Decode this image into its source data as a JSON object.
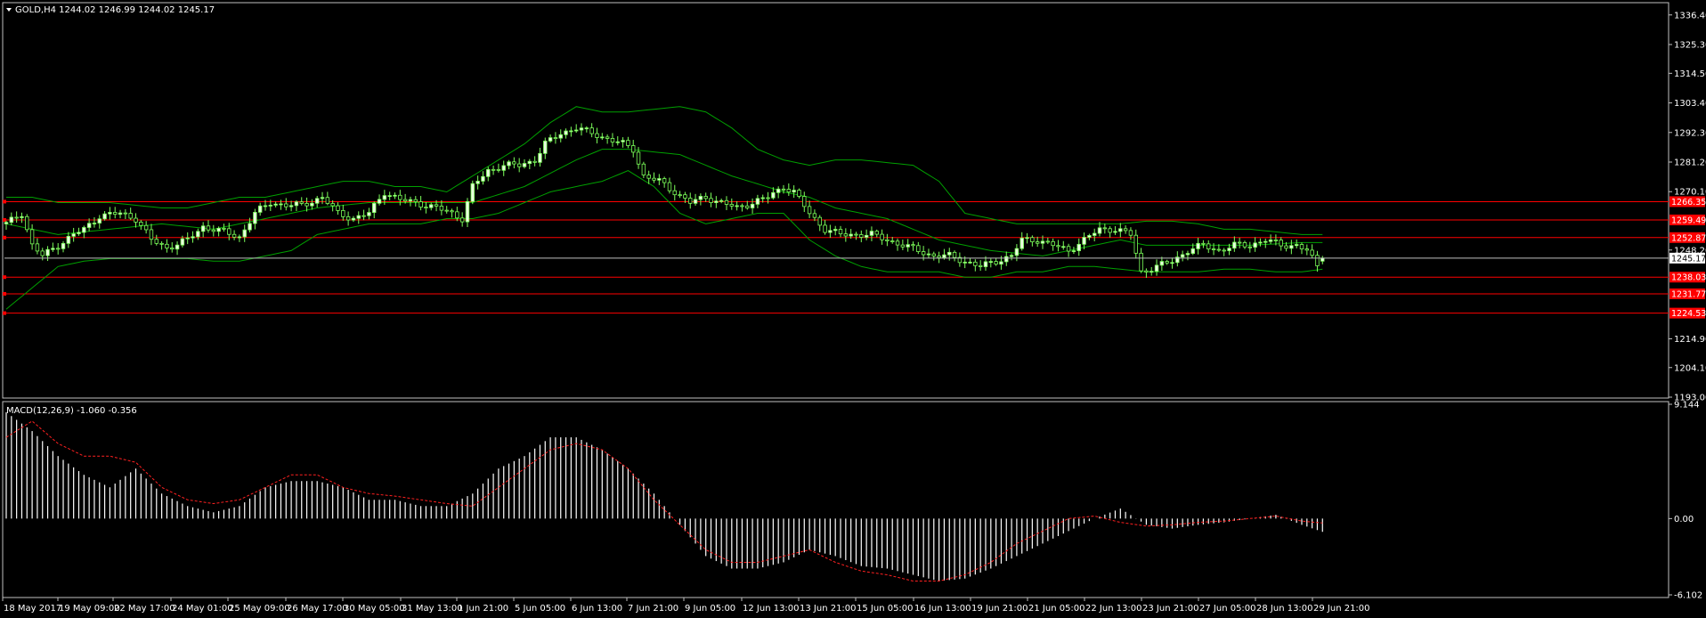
{
  "header": {
    "symbol_line": "GOLD,H4  1244.02 1246.99 1244.02 1245.17",
    "macd_line": "MACD(12,26,9) -1.060 -0.356"
  },
  "colors": {
    "background": "#000000",
    "frame": "#c0c0c0",
    "bull_body": "#e9ffe0",
    "candle_outline": "#7cff5a",
    "bollinger": "#00a000",
    "level_line": "#ff0000",
    "level_tag": "#ff0000",
    "current_price_line": "#c0c0c0",
    "macd_hist": "#ffffff",
    "macd_signal": "#ff2020"
  },
  "chart_data": [
    {
      "type": "candlestick",
      "symbol": "GOLD",
      "timeframe": "H4",
      "ohlc_last": {
        "open": 1244.02,
        "high": 1246.99,
        "low": 1244.02,
        "close": 1245.17
      },
      "price_ticks": [
        "1336.40",
        "1325.30",
        "1314.50",
        "1303.40",
        "1292.30",
        "1281.20",
        "1270.10",
        "1248.20",
        "1214.90",
        "1204.10",
        "1193.00"
      ],
      "ylim": [
        1193.0,
        1340.0
      ],
      "current_price": "1245.17",
      "levels": [
        {
          "label": "1266.35",
          "value": 1266.35
        },
        {
          "label": "1259.49",
          "value": 1259.49
        },
        {
          "label": "1252.87",
          "value": 1252.87
        },
        {
          "label": "1238.03",
          "value": 1238.03
        },
        {
          "label": "1231.77",
          "value": 1231.77
        },
        {
          "label": "1224.53",
          "value": 1224.53
        }
      ],
      "x_ticks": [
        "18 May 2017",
        "19 May 09:00",
        "22 May 17:00",
        "24 May 01:00",
        "25 May 09:00",
        "26 May 17:00",
        "30 May 05:00",
        "31 May 13:00",
        "1 Jun 21:00",
        "5 Jun 05:00",
        "6 Jun 13:00",
        "7 Jun 21:00",
        "9 Jun 05:00",
        "12 Jun 13:00",
        "13 Jun 21:00",
        "15 Jun 05:00",
        "16 Jun 13:00",
        "19 Jun 21:00",
        "21 Jun 05:00",
        "22 Jun 13:00",
        "23 Jun 21:00",
        "27 Jun 05:00",
        "28 Jun 13:00",
        "29 Jun 21:00"
      ],
      "close_path": [
        [
          0,
          1258
        ],
        [
          3,
          1262
        ],
        [
          5,
          1250
        ],
        [
          7,
          1246
        ],
        [
          10,
          1250
        ],
        [
          13,
          1254
        ],
        [
          15,
          1256
        ],
        [
          18,
          1261
        ],
        [
          22,
          1262
        ],
        [
          25,
          1260
        ],
        [
          28,
          1252
        ],
        [
          31,
          1249
        ],
        [
          35,
          1252
        ],
        [
          38,
          1257
        ],
        [
          42,
          1255
        ],
        [
          45,
          1253
        ],
        [
          48,
          1262
        ],
        [
          51,
          1266
        ],
        [
          54,
          1265
        ],
        [
          57,
          1265
        ],
        [
          61,
          1268
        ],
        [
          64,
          1262
        ],
        [
          67,
          1260
        ],
        [
          70,
          1262
        ],
        [
          73,
          1270
        ],
        [
          76,
          1267
        ],
        [
          79,
          1266
        ],
        [
          83,
          1264
        ],
        [
          86,
          1262
        ],
        [
          88,
          1260
        ],
        [
          90,
          1272
        ],
        [
          93,
          1278
        ],
        [
          96,
          1280
        ],
        [
          99,
          1280
        ],
        [
          102,
          1282
        ],
        [
          104,
          1288
        ],
        [
          107,
          1292
        ],
        [
          110,
          1294
        ],
        [
          113,
          1292
        ],
        [
          116,
          1290
        ],
        [
          119,
          1288
        ],
        [
          121,
          1286
        ],
        [
          123,
          1276
        ],
        [
          126,
          1274
        ],
        [
          129,
          1270
        ],
        [
          132,
          1266
        ],
        [
          135,
          1268
        ],
        [
          138,
          1266
        ],
        [
          141,
          1264
        ],
        [
          144,
          1266
        ],
        [
          147,
          1268
        ],
        [
          150,
          1272
        ],
        [
          152,
          1270
        ],
        [
          155,
          1262
        ],
        [
          158,
          1256
        ],
        [
          161,
          1254
        ],
        [
          164,
          1254
        ],
        [
          167,
          1254
        ],
        [
          170,
          1252
        ],
        [
          173,
          1250
        ],
        [
          176,
          1248
        ],
        [
          179,
          1246
        ],
        [
          182,
          1246
        ],
        [
          185,
          1244
        ],
        [
          188,
          1242
        ],
        [
          191,
          1244
        ],
        [
          194,
          1246
        ],
        [
          196,
          1252
        ],
        [
          199,
          1252
        ],
        [
          202,
          1250
        ],
        [
          205,
          1248
        ],
        [
          208,
          1252
        ],
        [
          211,
          1256
        ],
        [
          214,
          1256
        ],
        [
          217,
          1254
        ],
        [
          219,
          1240
        ],
        [
          222,
          1242
        ],
        [
          225,
          1244
        ],
        [
          228,
          1248
        ],
        [
          231,
          1250
        ],
        [
          234,
          1248
        ],
        [
          237,
          1250
        ],
        [
          240,
          1250
        ],
        [
          243,
          1252
        ],
        [
          246,
          1250
        ],
        [
          249,
          1250
        ],
        [
          251,
          1248
        ],
        [
          253,
          1242
        ],
        [
          256,
          1245
        ]
      ],
      "bollinger_upper": [
        [
          0,
          1268
        ],
        [
          5,
          1268
        ],
        [
          10,
          1266
        ],
        [
          15,
          1266
        ],
        [
          20,
          1266
        ],
        [
          25,
          1265
        ],
        [
          30,
          1264
        ],
        [
          35,
          1264
        ],
        [
          40,
          1266
        ],
        [
          45,
          1268
        ],
        [
          50,
          1268
        ],
        [
          55,
          1270
        ],
        [
          60,
          1272
        ],
        [
          65,
          1274
        ],
        [
          70,
          1274
        ],
        [
          75,
          1272
        ],
        [
          80,
          1272
        ],
        [
          85,
          1270
        ],
        [
          90,
          1276
        ],
        [
          95,
          1282
        ],
        [
          100,
          1288
        ],
        [
          105,
          1296
        ],
        [
          110,
          1302
        ],
        [
          115,
          1300
        ],
        [
          120,
          1300
        ],
        [
          125,
          1301
        ],
        [
          130,
          1302
        ],
        [
          135,
          1300
        ],
        [
          140,
          1294
        ],
        [
          145,
          1286
        ],
        [
          150,
          1282
        ],
        [
          155,
          1280
        ],
        [
          160,
          1282
        ],
        [
          165,
          1282
        ],
        [
          170,
          1281
        ],
        [
          175,
          1280
        ],
        [
          180,
          1274
        ],
        [
          185,
          1262
        ],
        [
          190,
          1260
        ],
        [
          195,
          1258
        ],
        [
          200,
          1258
        ],
        [
          205,
          1258
        ],
        [
          210,
          1258
        ],
        [
          215,
          1258
        ],
        [
          220,
          1259
        ],
        [
          225,
          1259
        ],
        [
          230,
          1258
        ],
        [
          235,
          1256
        ],
        [
          240,
          1256
        ],
        [
          245,
          1255
        ],
        [
          250,
          1254
        ],
        [
          254,
          1254
        ]
      ],
      "bollinger_middle": [
        [
          0,
          1258
        ],
        [
          10,
          1254
        ],
        [
          20,
          1256
        ],
        [
          30,
          1258
        ],
        [
          40,
          1256
        ],
        [
          50,
          1260
        ],
        [
          60,
          1264
        ],
        [
          70,
          1266
        ],
        [
          80,
          1266
        ],
        [
          90,
          1266
        ],
        [
          100,
          1272
        ],
        [
          110,
          1282
        ],
        [
          115,
          1286
        ],
        [
          120,
          1286
        ],
        [
          130,
          1284
        ],
        [
          140,
          1276
        ],
        [
          150,
          1270
        ],
        [
          155,
          1268
        ],
        [
          160,
          1264
        ],
        [
          170,
          1260
        ],
        [
          180,
          1252
        ],
        [
          190,
          1248
        ],
        [
          200,
          1246
        ],
        [
          210,
          1250
        ],
        [
          215,
          1252
        ],
        [
          220,
          1250
        ],
        [
          230,
          1250
        ],
        [
          240,
          1250
        ],
        [
          250,
          1251
        ],
        [
          254,
          1251
        ]
      ],
      "bollinger_lower": [
        [
          0,
          1226
        ],
        [
          5,
          1234
        ],
        [
          10,
          1242
        ],
        [
          15,
          1244
        ],
        [
          20,
          1245
        ],
        [
          25,
          1245
        ],
        [
          30,
          1245
        ],
        [
          35,
          1245
        ],
        [
          40,
          1244
        ],
        [
          45,
          1244
        ],
        [
          50,
          1246
        ],
        [
          55,
          1248
        ],
        [
          60,
          1254
        ],
        [
          65,
          1256
        ],
        [
          70,
          1258
        ],
        [
          75,
          1258
        ],
        [
          80,
          1258
        ],
        [
          85,
          1260
        ],
        [
          90,
          1260
        ],
        [
          95,
          1262
        ],
        [
          100,
          1266
        ],
        [
          105,
          1270
        ],
        [
          110,
          1272
        ],
        [
          115,
          1274
        ],
        [
          120,
          1278
        ],
        [
          125,
          1272
        ],
        [
          130,
          1262
        ],
        [
          135,
          1258
        ],
        [
          140,
          1260
        ],
        [
          145,
          1262
        ],
        [
          150,
          1262
        ],
        [
          155,
          1252
        ],
        [
          160,
          1246
        ],
        [
          165,
          1242
        ],
        [
          170,
          1240
        ],
        [
          175,
          1240
        ],
        [
          180,
          1240
        ],
        [
          185,
          1238
        ],
        [
          190,
          1238
        ],
        [
          195,
          1240
        ],
        [
          200,
          1240
        ],
        [
          205,
          1242
        ],
        [
          210,
          1242
        ],
        [
          215,
          1241
        ],
        [
          220,
          1240
        ],
        [
          225,
          1240
        ],
        [
          230,
          1240
        ],
        [
          235,
          1241
        ],
        [
          240,
          1241
        ],
        [
          245,
          1240
        ],
        [
          250,
          1240
        ],
        [
          254,
          1241
        ]
      ]
    },
    {
      "type": "bar",
      "indicator": "MACD(12,26,9)",
      "values_last": {
        "main": -1.06,
        "signal": -0.356
      },
      "y_ticks": [
        "9.144",
        "0.00",
        "-6.102"
      ],
      "ylim": [
        -6.102,
        9.144
      ],
      "histogram_path": [
        [
          0,
          8.5
        ],
        [
          5,
          7
        ],
        [
          10,
          5
        ],
        [
          15,
          3.5
        ],
        [
          20,
          2.5
        ],
        [
          25,
          4
        ],
        [
          30,
          2
        ],
        [
          35,
          1
        ],
        [
          40,
          0.5
        ],
        [
          45,
          1
        ],
        [
          50,
          2.5
        ],
        [
          55,
          3
        ],
        [
          60,
          3
        ],
        [
          65,
          2.5
        ],
        [
          70,
          1.5
        ],
        [
          75,
          1.5
        ],
        [
          80,
          1
        ],
        [
          85,
          1
        ],
        [
          90,
          2
        ],
        [
          95,
          4
        ],
        [
          100,
          5
        ],
        [
          105,
          6.5
        ],
        [
          110,
          6.5
        ],
        [
          115,
          5.5
        ],
        [
          120,
          4
        ],
        [
          125,
          2
        ],
        [
          130,
          -0.5
        ],
        [
          135,
          -3
        ],
        [
          140,
          -4
        ],
        [
          145,
          -4
        ],
        [
          150,
          -3.5
        ],
        [
          155,
          -2.5
        ],
        [
          160,
          -3
        ],
        [
          165,
          -3.8
        ],
        [
          170,
          -4
        ],
        [
          175,
          -4.5
        ],
        [
          180,
          -5
        ],
        [
          185,
          -4.8
        ],
        [
          190,
          -4
        ],
        [
          195,
          -3
        ],
        [
          200,
          -2
        ],
        [
          205,
          -1
        ],
        [
          210,
          0
        ],
        [
          215,
          0.8
        ],
        [
          220,
          -0.5
        ],
        [
          225,
          -0.8
        ],
        [
          230,
          -0.5
        ],
        [
          235,
          -0.3
        ],
        [
          240,
          0
        ],
        [
          245,
          0.3
        ],
        [
          250,
          -0.5
        ],
        [
          254,
          -1.06
        ]
      ],
      "signal_path": [
        [
          0,
          6.5
        ],
        [
          5,
          7.8
        ],
        [
          10,
          6
        ],
        [
          15,
          5
        ],
        [
          20,
          5
        ],
        [
          25,
          4.5
        ],
        [
          30,
          2.5
        ],
        [
          35,
          1.5
        ],
        [
          40,
          1.2
        ],
        [
          45,
          1.5
        ],
        [
          50,
          2.5
        ],
        [
          55,
          3.5
        ],
        [
          60,
          3.5
        ],
        [
          65,
          2.5
        ],
        [
          70,
          2
        ],
        [
          75,
          1.8
        ],
        [
          80,
          1.5
        ],
        [
          85,
          1.2
        ],
        [
          90,
          1
        ],
        [
          95,
          2.5
        ],
        [
          100,
          4
        ],
        [
          105,
          5.5
        ],
        [
          110,
          6
        ],
        [
          115,
          5.5
        ],
        [
          120,
          4
        ],
        [
          125,
          1.5
        ],
        [
          130,
          -0.5
        ],
        [
          135,
          -2.5
        ],
        [
          140,
          -3.5
        ],
        [
          145,
          -3.5
        ],
        [
          150,
          -3
        ],
        [
          155,
          -2.5
        ],
        [
          160,
          -3.5
        ],
        [
          165,
          -4.2
        ],
        [
          170,
          -4.5
        ],
        [
          175,
          -5
        ],
        [
          180,
          -5
        ],
        [
          185,
          -4.5
        ],
        [
          190,
          -3.5
        ],
        [
          195,
          -2
        ],
        [
          200,
          -1
        ],
        [
          205,
          0
        ],
        [
          210,
          0.2
        ],
        [
          215,
          -0.3
        ],
        [
          220,
          -0.6
        ],
        [
          225,
          -0.5
        ],
        [
          230,
          -0.3
        ],
        [
          235,
          -0.2
        ],
        [
          240,
          0
        ],
        [
          245,
          0.2
        ],
        [
          250,
          -0.2
        ],
        [
          254,
          -0.356
        ]
      ]
    }
  ]
}
